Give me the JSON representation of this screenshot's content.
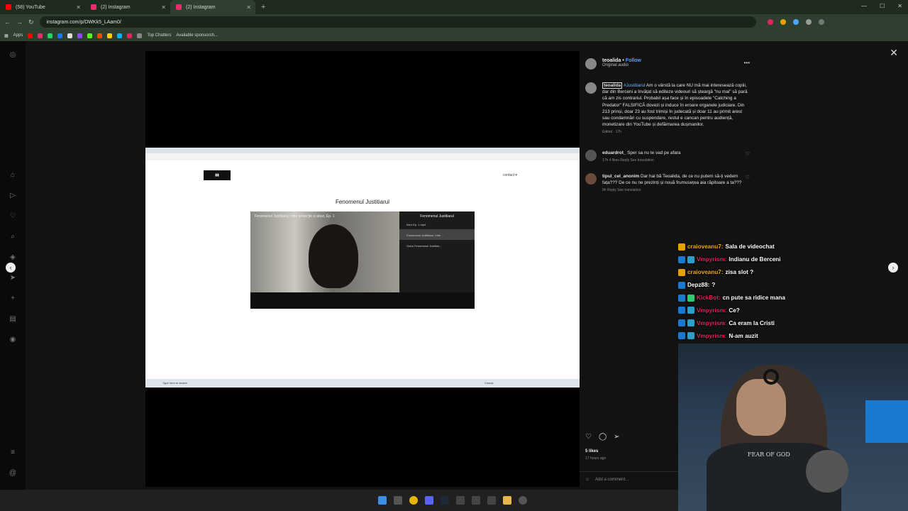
{
  "browser": {
    "tabs": [
      {
        "label": "(58) YouTube",
        "color": "#ff0000"
      },
      {
        "label": "(2) Instagram",
        "color": "#e1306c"
      },
      {
        "label": "(2) Instagram",
        "color": "#e1306c",
        "active": true
      }
    ],
    "url": "instagram.com/p/DWKk5_LAam0/",
    "bookmarks": {
      "apps": "Apps",
      "top_chatters": "Top Chatters",
      "sponsors": "Available sponsorsh..."
    }
  },
  "inner_screen": {
    "page_title": "Fenomenul Justitiarul",
    "contact": "contact ▾",
    "video_title": "Fenomenul Justitiarul, între protecție și abuz, Ep. 1",
    "playlist_header": "Fenomenul Justitiarul",
    "playlist_items": [
      "Intro Ep. 1.mp4",
      "Fenomenul Justitiarul, între ...",
      "Outro Fenomenul Justitiar..."
    ],
    "search_placeholder": "Type here to search",
    "weather": "Cloudy"
  },
  "post": {
    "author": "teoalida",
    "follow_label": "Follow",
    "audio": "Original audio",
    "caption_author": "teoalida",
    "caption_tag": "#Justitiarul",
    "caption_body": " Am o vârstă la care NU mă mai interesează copiii, dar din Berceni a învățat să editeze videouri să șteargă \"nu mai\" să pară că am zis contrariul. Probabil așa face și în episoadele \"Catching a Predator\" FALSIFICĂ dovezi și induce în eroare organele judiciare. Din 213 prinși, doar 23 au fost trimiși în judecată și doar 11 au primit arest sau condamnări cu suspendare, restul e cancan pentru audiență, monetizare din YouTube și defăimarea dușmanilor.",
    "edited": "Edited · 17h",
    "comments": [
      {
        "user": "eduardrot_",
        "text": "Sper sa nu te vad pe afara",
        "meta": "17h   4 likes   Reply   See translation"
      },
      {
        "user": "tipul_cel_anonim",
        "text": "Dar hai bă Teoalida, de ce nu putem să-ți vedem fața??? De ce nu ne prezinți și nouă frumusețea aia răpitoare a ta???",
        "meta": "8h   Reply   See translation"
      }
    ],
    "likes": "5 likes",
    "ago": "17 hours ago",
    "add_comment": "Add a comment..."
  },
  "chat": [
    {
      "user": "craioveanu7:",
      "msg": "Sala de videochat",
      "color": "#f0a81e"
    },
    {
      "user": "Vmpyrism:",
      "msg": "Indianu de Berceni",
      "color": "#e0245e"
    },
    {
      "user": "craioveanu7:",
      "msg": "zisa slot ?",
      "color": "#f0a81e"
    },
    {
      "user": "Depz88:",
      "msg": "?",
      "color": "#ffffff"
    },
    {
      "user": "KickBot:",
      "msg": "cn pute sa ridice mana",
      "color": "#e0245e"
    },
    {
      "user": "Vmpyrism:",
      "msg": "Ce?",
      "color": "#e0245e"
    },
    {
      "user": "Vmpyrism:",
      "msg": "Ca eram la Cristi",
      "color": "#e0245e"
    },
    {
      "user": "Vmpyrism:",
      "msg": "N-am auzit",
      "color": "#e0245e"
    }
  ],
  "webcam": {
    "shirt_text": "FEAR OF GOD"
  }
}
